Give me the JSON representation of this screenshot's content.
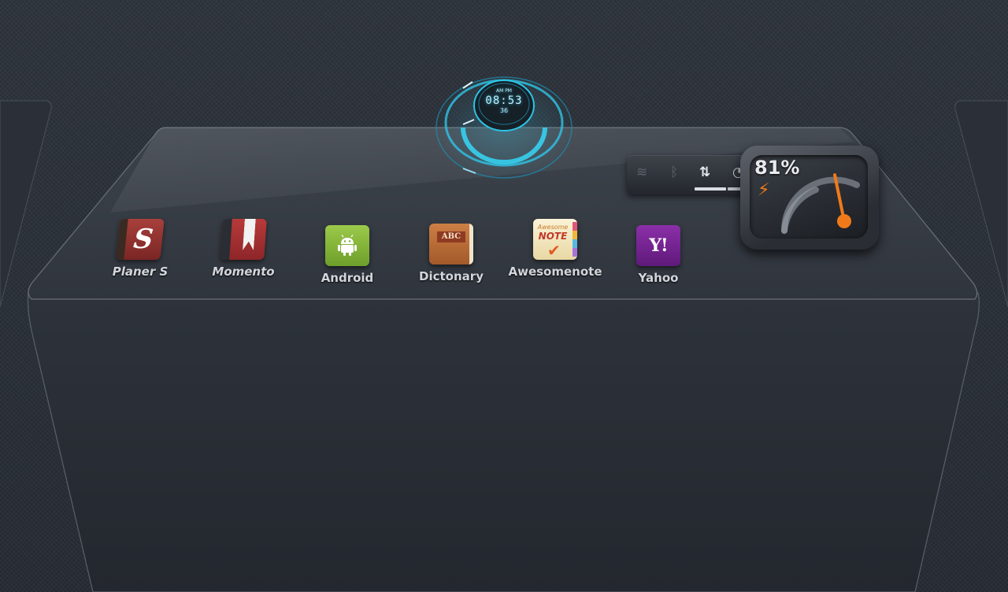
{
  "apps": [
    {
      "label": "Planer S",
      "icon": "planer-s-icon",
      "glyph": "S"
    },
    {
      "label": "Momento",
      "icon": "momento-icon"
    },
    {
      "label": "Android",
      "icon": "android-icon"
    },
    {
      "label": "Dictonary",
      "icon": "dictionary-icon",
      "plate": "ABC"
    },
    {
      "label": "Awesomenote",
      "icon": "awesomenote-icon",
      "line1": "Awesome",
      "line2": "NOTE",
      "check": "✔"
    },
    {
      "label": "Yahoo",
      "icon": "yahoo-icon",
      "glyph": "Y!"
    }
  ],
  "clock": {
    "ampm": "AM PM",
    "time": "08:53",
    "seconds": "36"
  },
  "status_toggles": {
    "icons": [
      "wifi-icon",
      "bluetooth-icon",
      "data-sync-icon",
      "gps-icon"
    ],
    "glyphs": [
      "≋",
      "ᛒ",
      "⇅",
      "◔"
    ],
    "states": [
      false,
      false,
      true,
      true
    ]
  },
  "battery": {
    "percent_label": "81%",
    "level": 0.81,
    "charging": true,
    "bolt": "⚡"
  },
  "colors": {
    "accent_cyan": "#2ec4e6",
    "battery_orange": "#f07a1a",
    "label_text": "#d2d6dc"
  }
}
